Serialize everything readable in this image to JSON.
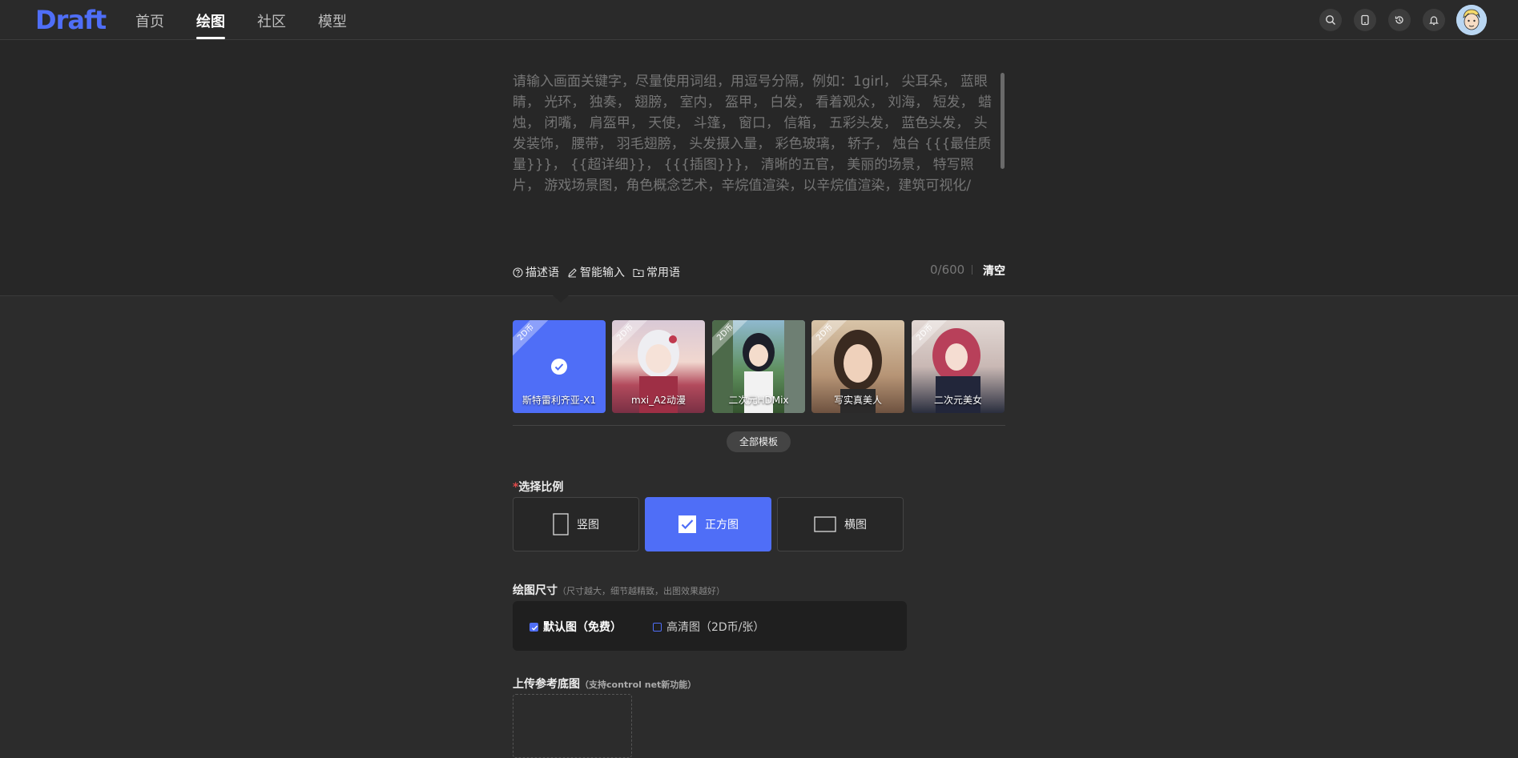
{
  "nav": {
    "logo": "Draft",
    "items": [
      "首页",
      "绘图",
      "社区",
      "模型"
    ],
    "active_index": 1,
    "icons": [
      "search-icon",
      "tablet-icon",
      "history-icon",
      "bell-icon"
    ]
  },
  "prompt": {
    "placeholder": "请输入画面关键字，尽量使用词组，用逗号分隔，例如：1girl， 尖耳朵， 蓝眼睛， 光环， 独奏， 翅膀， 室内， 盔甲， 白发， 看着观众， 刘海， 短发， 蜡烛， 闭嘴， 肩盔甲， 天使， 斗篷， 窗口， 信箱， 五彩头发， 蓝色头发， 头发装饰， 腰带， 羽毛翅膀， 头发摄入量， 彩色玻璃， 轿子， 烛台 {{{最佳质量}}}， {{超详细}}， {{{插图}}}， 清晰的五官， 美丽的场景， 特写照片， 游戏场景图，角色概念艺术，辛烷值渲染，以辛烷值渲染，建筑可视化/",
    "value": "",
    "tools": [
      "描述语",
      "智能输入",
      "常用语"
    ],
    "counter": "0/600",
    "clear_label": "清空"
  },
  "templates": {
    "badge": "2D币",
    "cards": [
      {
        "label": "斯特雷利齐亚-X1",
        "selected": true
      },
      {
        "label": "mxi_A2动漫",
        "selected": false
      },
      {
        "label": "二次元HDMix",
        "selected": false
      },
      {
        "label": "写实真美人",
        "selected": false
      },
      {
        "label": "二次元美女",
        "selected": false
      }
    ],
    "all_label": "全部模板"
  },
  "ratio": {
    "label": "选择比例",
    "required_mark": "*",
    "options": [
      {
        "label": "竖图",
        "selected": false
      },
      {
        "label": "正方图",
        "selected": true
      },
      {
        "label": "横图",
        "selected": false
      }
    ]
  },
  "size": {
    "label": "绘图尺寸",
    "hint": "（尺寸越大，细节越精致，出图效果越好）",
    "options": [
      {
        "label": "默认图（免费）",
        "checked": true
      },
      {
        "label": "高清图（2D币/张）",
        "checked": false
      }
    ]
  },
  "upload": {
    "label": "上传参考底图",
    "hint": "（支持control net新功能）"
  },
  "colors": {
    "accent": "#4f6ef7",
    "background": "#2c2c2c",
    "prompt_background": "#272727"
  }
}
